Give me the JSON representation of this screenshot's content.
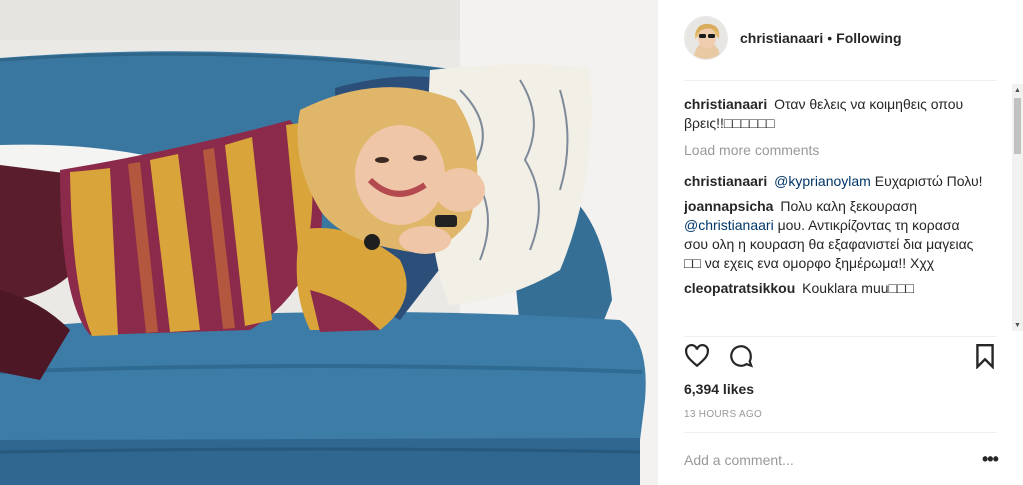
{
  "photo": {
    "alt_icon": "post-photo"
  },
  "header": {
    "username": "christianaari",
    "separator": "•",
    "follow_status": "Following"
  },
  "comments": {
    "caption": {
      "user": "christianaari",
      "text": "Οταν θελεις να κοιμηθεις οπου βρεις!!□□□□□□"
    },
    "load_more": "Load more comments",
    "items": [
      {
        "user": "christianaari",
        "mention": "@kyprianoylam",
        "text": " Ευχαριστώ Πολυ!"
      },
      {
        "user": "joannapsicha",
        "text_before": "Πολυ καλη ξεκουραση ",
        "mention": "@christianaari",
        "text_after": " μου. Αντικρίζοντας τη κορασα σου ολη η κουραση θα εξαφανιστεί δια μαγειας □□ να εχεις ενα ομορφο ξημέρωμα!! Χχχ"
      },
      {
        "user": "cleopatratsikkou",
        "text": "Kouklara muu□□□"
      }
    ]
  },
  "actions": {
    "like_icon": "heart-icon",
    "comment_icon": "comment-icon",
    "save_icon": "bookmark-icon"
  },
  "likes": "6,394 likes",
  "time_ago": "13 HOURS AGO",
  "add_comment": {
    "placeholder": "Add a comment..."
  },
  "more_options": "•••",
  "colors": {
    "text": "#262626",
    "muted": "#999999",
    "mention": "#003569",
    "divider": "#efefef",
    "sofa": "#3f7aa0"
  }
}
